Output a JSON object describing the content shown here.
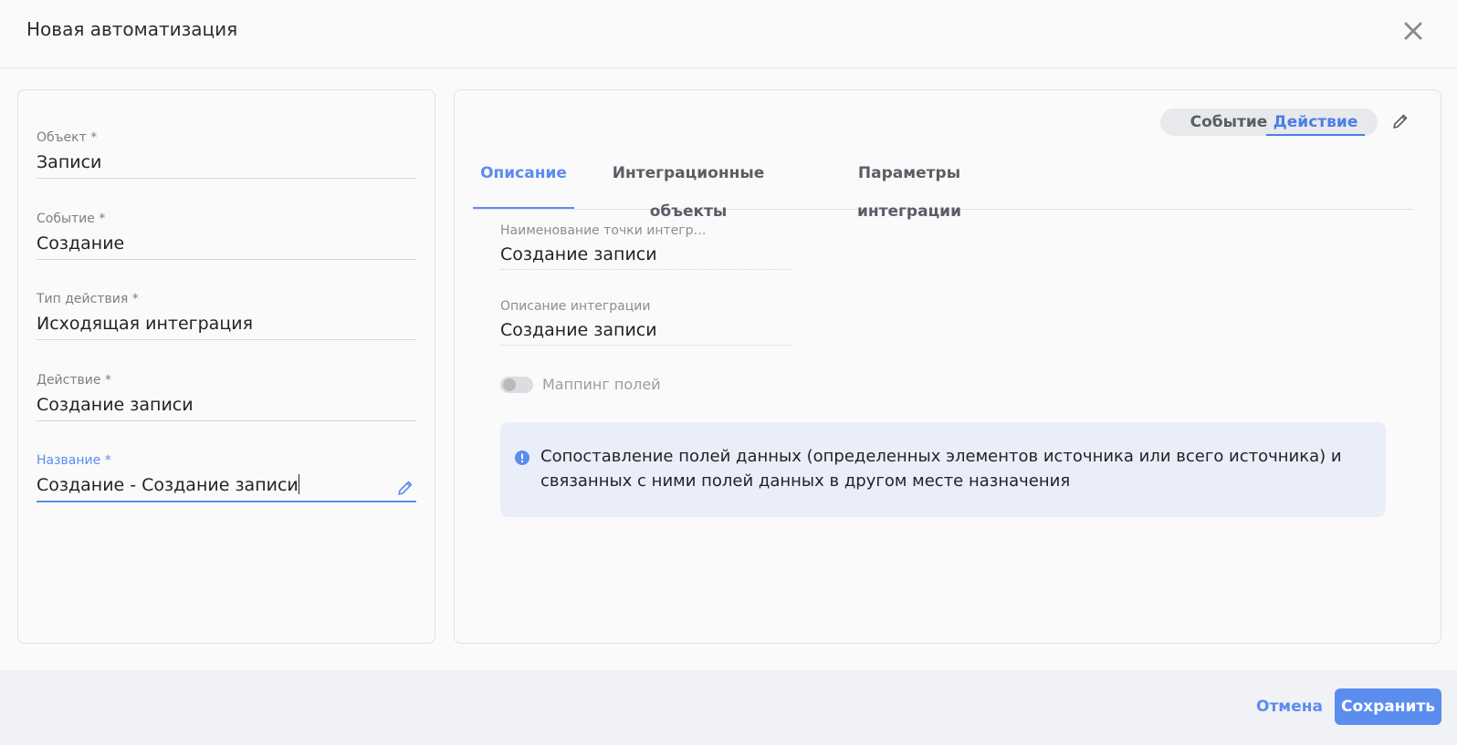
{
  "header": {
    "title": "Новая автоматизация"
  },
  "left": {
    "fields": [
      {
        "label": "Объект *",
        "value": "Записи"
      },
      {
        "label": "Событие *",
        "value": "Создание"
      },
      {
        "label": "Тип действия *",
        "value": "Исходящая интеграция"
      },
      {
        "label": "Действие *",
        "value": "Создание записи"
      },
      {
        "label": "Название *",
        "value": "Создание - Создание записи"
      }
    ]
  },
  "right": {
    "segment": {
      "option1": "Событие",
      "option2": "Действие",
      "selected": "Действие"
    },
    "tabs": [
      "Описание",
      "Интеграционные объекты",
      "Параметры интеграции"
    ],
    "active_tab": "Описание",
    "fields": [
      {
        "label": "Наименование точки интегр…",
        "value": "Создание записи"
      },
      {
        "label": "Описание интеграции",
        "value": "Создание записи"
      }
    ],
    "toggle": {
      "label": "Маппинг полей",
      "on": false
    },
    "info": "Сопоставление полей данных (определенных элементов источника или всего источника) и связанных с ними полей данных в другом месте назначения"
  },
  "footer": {
    "cancel_label": "Отмена",
    "save_label": "Сохранить"
  },
  "colors": {
    "accent": "#5b8def",
    "info_bg": "#e9eef8"
  }
}
